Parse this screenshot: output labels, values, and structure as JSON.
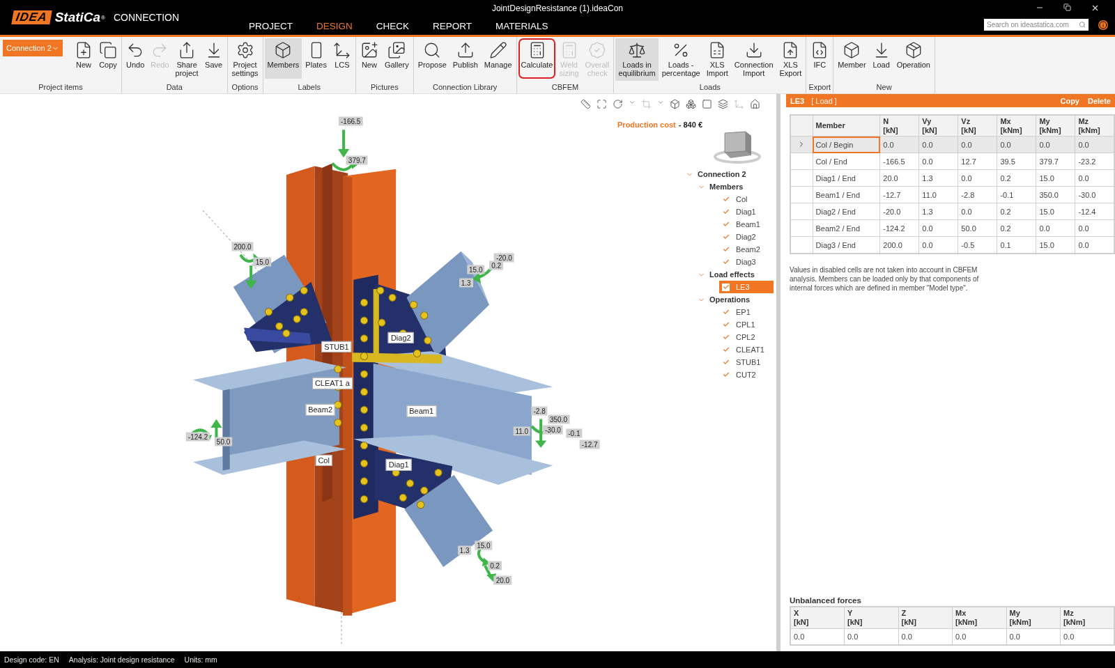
{
  "window": {
    "title": "JointDesignResistance (1).ideaCon"
  },
  "logo": {
    "mark": "IDEA",
    "name": "StatiCa",
    "registered": "®",
    "product": "CONNECTION"
  },
  "menu_tabs": [
    {
      "label": "PROJECT",
      "selected": false
    },
    {
      "label": "DESIGN",
      "selected": true
    },
    {
      "label": "CHECK",
      "selected": false
    },
    {
      "label": "REPORT",
      "selected": false
    },
    {
      "label": "MATERIALS",
      "selected": false
    }
  ],
  "search": {
    "placeholder": "Search on ideastatica.com"
  },
  "ribbon": {
    "connection_select": {
      "value": "Connection 2"
    },
    "groups": [
      {
        "label": "Project items",
        "buttons": [
          {
            "label": "New",
            "selected": false,
            "disabled": false,
            "highlighted": false
          },
          {
            "label": "Copy",
            "selected": false,
            "disabled": false,
            "highlighted": false
          }
        ]
      },
      {
        "label": "Data",
        "buttons": [
          {
            "label": "Undo",
            "selected": false,
            "disabled": false,
            "highlighted": false
          },
          {
            "label": "Redo",
            "selected": false,
            "disabled": true,
            "highlighted": false
          },
          {
            "label": "Share project",
            "selected": false,
            "disabled": false,
            "highlighted": false
          },
          {
            "label": "Save",
            "selected": false,
            "disabled": false,
            "highlighted": false
          }
        ]
      },
      {
        "label": "Options",
        "buttons": [
          {
            "label": "Project settings",
            "selected": false,
            "disabled": false,
            "highlighted": false
          }
        ]
      },
      {
        "label": "Labels",
        "buttons": [
          {
            "label": "Members",
            "selected": true,
            "disabled": false,
            "highlighted": false
          },
          {
            "label": "Plates",
            "selected": false,
            "disabled": false,
            "highlighted": false
          },
          {
            "label": "LCS",
            "selected": false,
            "disabled": false,
            "highlighted": false
          }
        ]
      },
      {
        "label": "Pictures",
        "buttons": [
          {
            "label": "New",
            "selected": false,
            "disabled": false,
            "highlighted": false
          },
          {
            "label": "Gallery",
            "selected": false,
            "disabled": false,
            "highlighted": false
          }
        ]
      },
      {
        "label": "Connection Library",
        "buttons": [
          {
            "label": "Propose",
            "selected": false,
            "disabled": false,
            "highlighted": false
          },
          {
            "label": "Publish",
            "selected": false,
            "disabled": false,
            "highlighted": false
          },
          {
            "label": "Manage",
            "selected": false,
            "disabled": false,
            "highlighted": false
          }
        ]
      },
      {
        "label": "CBFEM",
        "buttons": [
          {
            "label": "Calculate",
            "selected": false,
            "disabled": false,
            "highlighted": true
          },
          {
            "label": "Weld sizing",
            "selected": false,
            "disabled": true,
            "highlighted": false
          },
          {
            "label": "Overall check",
            "selected": false,
            "disabled": true,
            "highlighted": false
          }
        ]
      },
      {
        "label": "Loads",
        "buttons": [
          {
            "label": "Loads in equilibrium",
            "selected": true,
            "disabled": false,
            "highlighted": false
          },
          {
            "label": "Loads - percentage",
            "selected": false,
            "disabled": false,
            "highlighted": false
          },
          {
            "label": "XLS Import",
            "selected": false,
            "disabled": false,
            "highlighted": false
          },
          {
            "label": "Connection Import",
            "selected": false,
            "disabled": false,
            "highlighted": false
          },
          {
            "label": "XLS Export",
            "selected": false,
            "disabled": false,
            "highlighted": false
          }
        ]
      },
      {
        "label": "Export",
        "buttons": [
          {
            "label": "IFC",
            "selected": false,
            "disabled": false,
            "highlighted": false
          }
        ]
      },
      {
        "label": "New",
        "buttons": [
          {
            "label": "Member",
            "selected": false,
            "disabled": false,
            "highlighted": false
          },
          {
            "label": "Load",
            "selected": false,
            "disabled": false,
            "highlighted": false
          },
          {
            "label": "Operation",
            "selected": false,
            "disabled": false,
            "highlighted": false
          }
        ]
      }
    ]
  },
  "viewport": {
    "production_cost": {
      "label": "Production cost",
      "value": "- 840 €"
    },
    "model_labels": [
      "STUB1",
      "Diag2",
      "CLEAT1 a",
      "Beam2",
      "Beam1",
      "Col",
      "Diag1"
    ],
    "load_labels": [
      "-166.5",
      "379.7",
      "200.0",
      "15.0",
      "-20.0",
      "15.0",
      "0.2",
      "1.3",
      "-2.8",
      "350.0",
      "-30.0",
      "-0.1",
      "-12.7",
      "11.0",
      "-124.2",
      "50.0",
      "1.3",
      "15.0",
      "0.2",
      "20.0"
    ]
  },
  "tree": [
    {
      "label": "Connection 2",
      "expanded": true,
      "children": [
        {
          "label": "Members",
          "expanded": true,
          "children": [
            {
              "label": "Col",
              "checked": true,
              "selected": false
            },
            {
              "label": "Diag1",
              "checked": true,
              "selected": false
            },
            {
              "label": "Beam1",
              "checked": true,
              "selected": false
            },
            {
              "label": "Diag2",
              "checked": true,
              "selected": false
            },
            {
              "label": "Beam2",
              "checked": true,
              "selected": false
            },
            {
              "label": "Diag3",
              "checked": true,
              "selected": false
            }
          ]
        },
        {
          "label": "Load effects",
          "expanded": true,
          "children": [
            {
              "label": "LE3",
              "checked": true,
              "selected": true
            }
          ]
        },
        {
          "label": "Operations",
          "expanded": true,
          "children": [
            {
              "label": "EP1",
              "checked": true,
              "selected": false
            },
            {
              "label": "CPL1",
              "checked": true,
              "selected": false
            },
            {
              "label": "CPL2",
              "checked": true,
              "selected": false
            },
            {
              "label": "CLEAT1",
              "checked": true,
              "selected": false
            },
            {
              "label": "STUB1",
              "checked": true,
              "selected": false
            },
            {
              "label": "CUT2",
              "checked": true,
              "selected": false
            }
          ]
        }
      ]
    }
  ],
  "load_panel": {
    "name": "LE3",
    "type": "[ Load ]",
    "actions": [
      "Copy",
      "Delete"
    ],
    "columns": [
      {
        "name": "Member"
      },
      {
        "name": "N",
        "unit": "[kN]"
      },
      {
        "name": "Vy",
        "unit": "[kN]"
      },
      {
        "name": "Vz",
        "unit": "[kN]"
      },
      {
        "name": "Mx",
        "unit": "[kNm]"
      },
      {
        "name": "My",
        "unit": "[kNm]"
      },
      {
        "name": "Mz",
        "unit": "[kNm]"
      }
    ],
    "rows": [
      {
        "member": "Col / Begin",
        "values": [
          "0.0",
          "0.0",
          "0.0",
          "0.0",
          "0.0",
          "0.0"
        ],
        "selected": true
      },
      {
        "member": "Col / End",
        "values": [
          "-166.5",
          "0.0",
          "12.7",
          "39.5",
          "379.7",
          "-23.2"
        ],
        "selected": false
      },
      {
        "member": "Diag1 / End",
        "values": [
          "20.0",
          "1.3",
          "0.0",
          "0.2",
          "15.0",
          "0.0"
        ],
        "selected": false
      },
      {
        "member": "Beam1 / End",
        "values": [
          "-12.7",
          "11.0",
          "-2.8",
          "-0.1",
          "350.0",
          "-30.0"
        ],
        "selected": false
      },
      {
        "member": "Diag2 / End",
        "values": [
          "-20.0",
          "1.3",
          "0.0",
          "0.2",
          "15.0",
          "-12.4"
        ],
        "selected": false
      },
      {
        "member": "Beam2 / End",
        "values": [
          "-124.2",
          "0.0",
          "50.0",
          "0.2",
          "0.0",
          "0.0"
        ],
        "selected": false
      },
      {
        "member": "Diag3 / End",
        "values": [
          "200.0",
          "0.0",
          "-0.5",
          "0.1",
          "15.0",
          "0.0"
        ],
        "selected": false
      }
    ],
    "note": "Values in disabled cells are not taken into account in CBFEM analysis. Members can be loaded only by that components of internal forces which are defined in member \"Model type\".",
    "unbalanced": {
      "title": "Unbalanced forces",
      "columns": [
        {
          "name": "X",
          "unit": "[kN]"
        },
        {
          "name": "Y",
          "unit": "[kN]"
        },
        {
          "name": "Z",
          "unit": "[kN]"
        },
        {
          "name": "Mx",
          "unit": "[kNm]"
        },
        {
          "name": "My",
          "unit": "[kNm]"
        },
        {
          "name": "Mz",
          "unit": "[kNm]"
        }
      ],
      "values": [
        "0.0",
        "0.0",
        "0.0",
        "0.0",
        "0.0",
        "0.0"
      ]
    }
  },
  "status_bar": [
    "Design code: EN",
    "Analysis: Joint design resistance",
    "Units: mm"
  ]
}
